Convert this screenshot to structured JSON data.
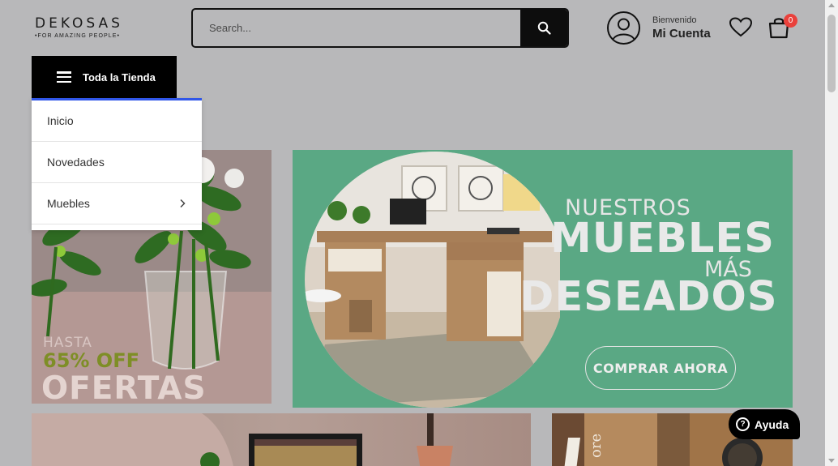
{
  "header": {
    "logo_main": "DEKOSAS",
    "logo_sub": "•FOR AMAZING PEOPLE•",
    "search_placeholder": "Search...",
    "account_greeting": "Bienvenido",
    "account_label": "Mi Cuenta",
    "cart_count": "0"
  },
  "nav": {
    "category_button": "Toda la Tienda",
    "menu_items": [
      {
        "label": "Inicio"
      },
      {
        "label": "Novedades"
      },
      {
        "label": "Muebles",
        "has_submenu": true
      }
    ]
  },
  "banners": {
    "left": {
      "line1": "HASTA",
      "line2": "65% OFF",
      "line3": "OFERTAS"
    },
    "main": {
      "line1": "NUESTROS",
      "line2": "MUEBLES",
      "line3": "MÁS",
      "line4": "DESEADOS",
      "cta": "COMPRAR AHORA"
    }
  },
  "help_button": "Ayuda",
  "colors": {
    "accent_blue": "#3056e8",
    "badge_red": "#e9413c",
    "banner_green": "#5aa884"
  }
}
